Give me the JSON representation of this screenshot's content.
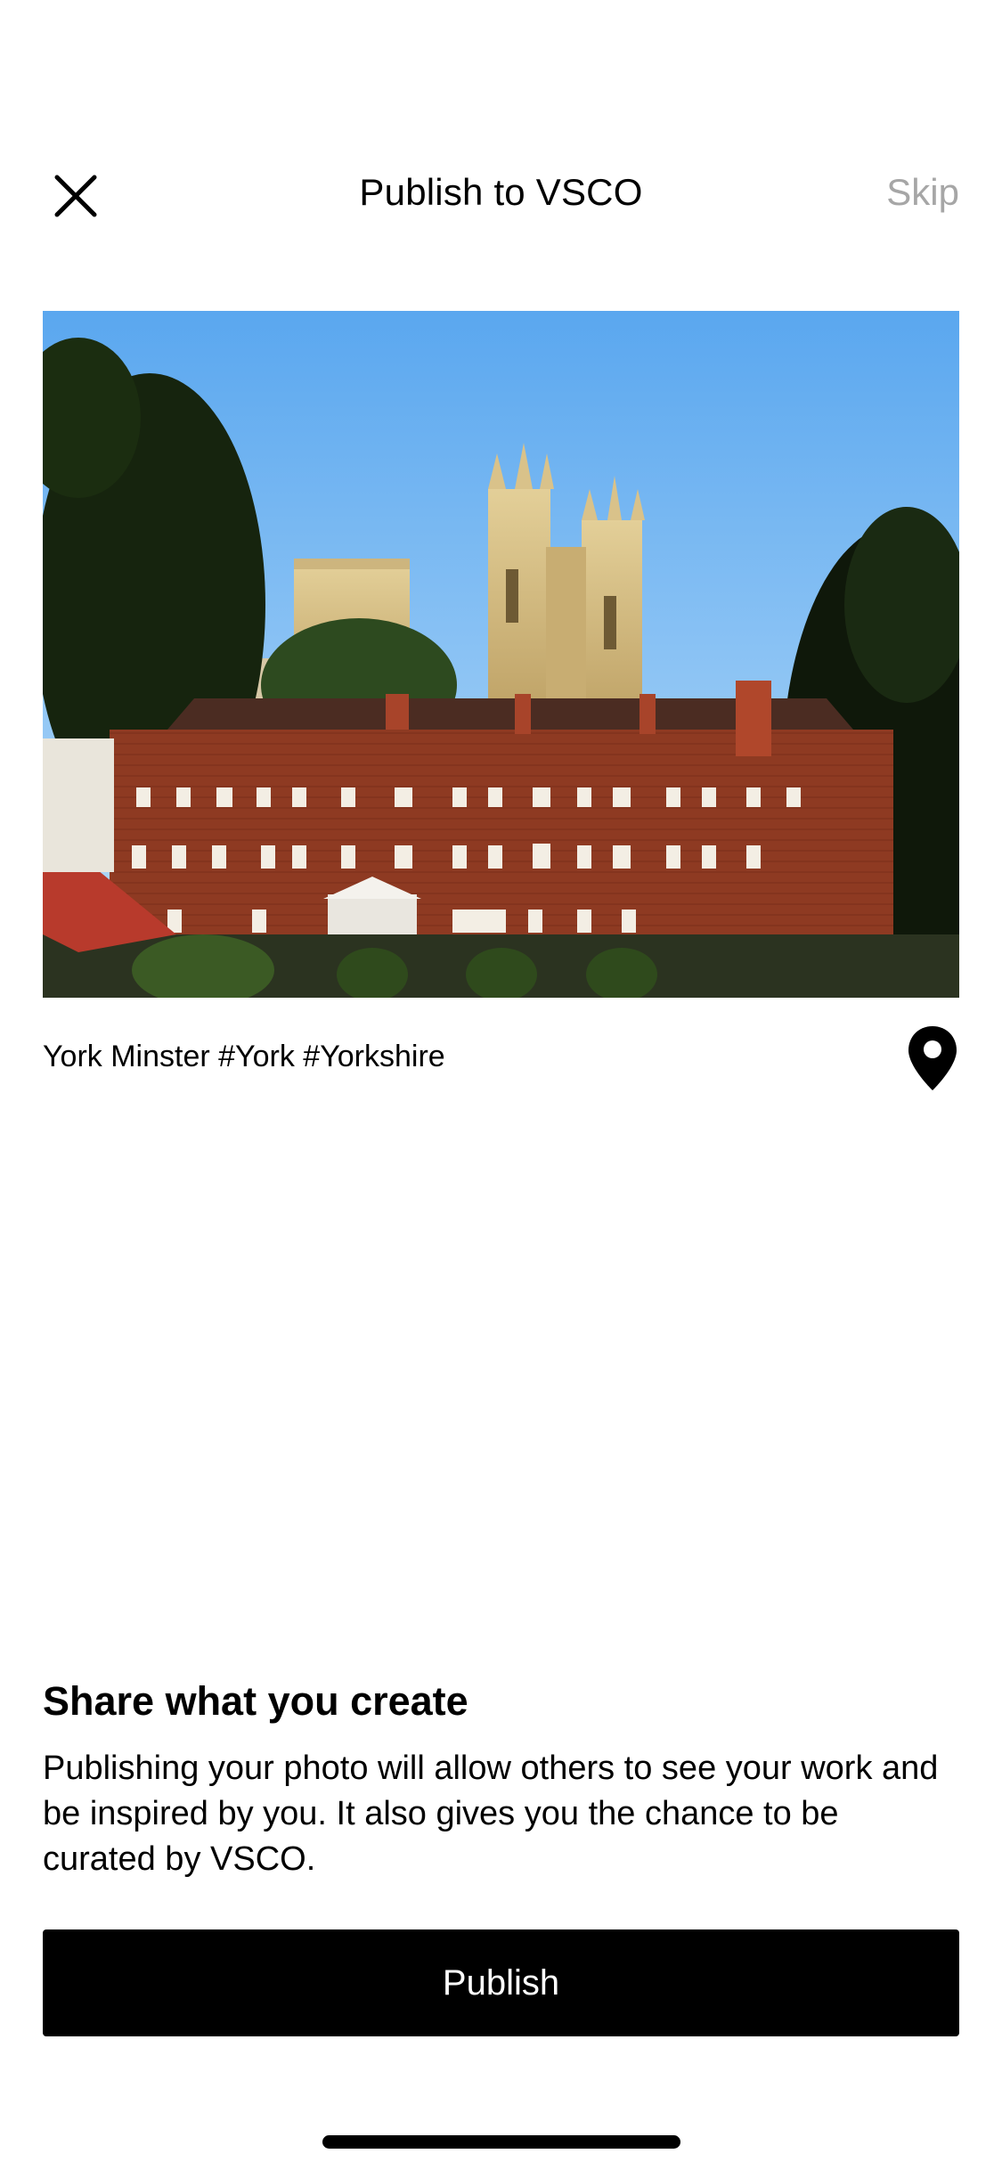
{
  "header": {
    "title": "Publish to VSCO",
    "skip_label": "Skip",
    "close_icon": "close-icon"
  },
  "photo": {
    "subject": "York Minster cathedral behind red brick building"
  },
  "caption": {
    "text": "York Minster #York #Yorkshire",
    "location_icon": "location-pin-icon"
  },
  "share": {
    "heading": "Share what you create",
    "body": "Publishing your photo will allow others to see your work and be inspired by you. It also gives you the chance to be curated by VSCO."
  },
  "publish_button": {
    "label": "Publish"
  },
  "colors": {
    "accent": "#000000",
    "muted": "#a6a6a6",
    "background": "#ffffff"
  }
}
